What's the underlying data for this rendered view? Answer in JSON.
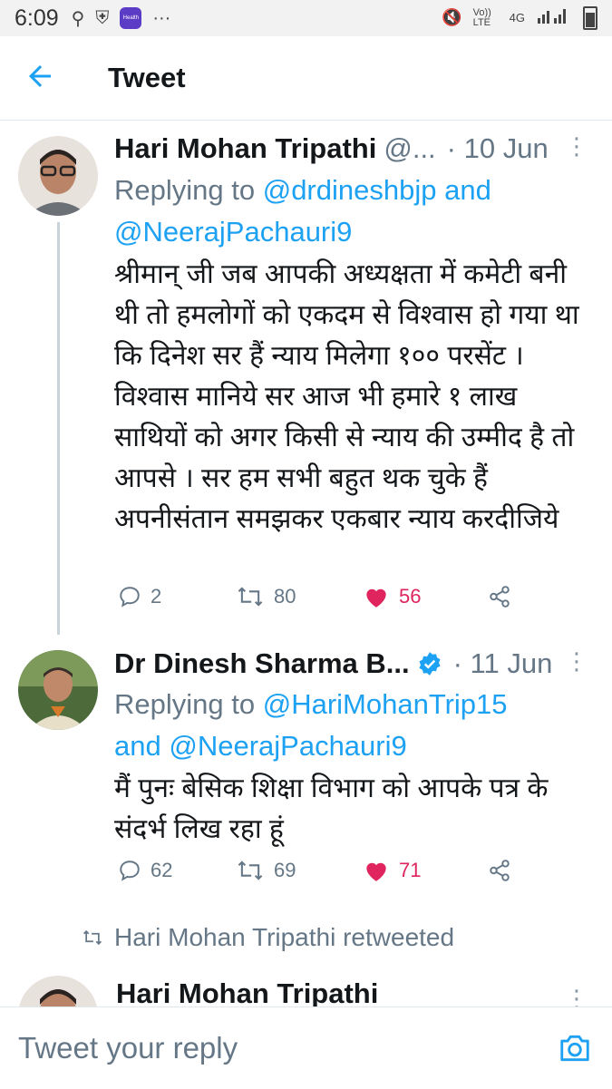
{
  "status_bar": {
    "time": "6:09",
    "dots": "···",
    "health_badge_label": "Health",
    "network": "4G",
    "volte": "Vo)) LTE"
  },
  "header": {
    "title": "Tweet"
  },
  "tweets": [
    {
      "name": "Hari Mohan Tripathi",
      "handle": "@...",
      "date": "· 10 Jun",
      "replying_prefix": "Replying to ",
      "mention_1": "@drdineshbjp",
      "and_word": "and",
      "mention_2": "@NeerajPachauri9",
      "body": "श्रीमान् जी जब आपकी अध्यक्षता में कमेटी बनी थी तो हमलोगों को एकदम से विश्वास हो गया था कि दिनेश सर हैं न्याय मिलेगा १०० परसेंट ।विश्वास मानिये सर आज भी हमारे १ लाख साथियों को अगर किसी से न्याय की उम्मीद है तो आपसे । सर हम सभी बहुत थक चुके हैं अपनीसंतान समझकर एकबार न्याय करदीजिये",
      "replies": "2",
      "retweets": "80",
      "likes": "56"
    },
    {
      "name": "Dr Dinesh Sharma B...",
      "date": "· 11 Jun",
      "replying_prefix": "Replying to ",
      "mention_1": "@HariMohanTrip15",
      "and_word": "and",
      "mention_2": "@NeerajPachauri9",
      "body": "मैं  पुनः बेसिक शिक्षा विभाग को आपके पत्र के संदर्भ लिख रहा हूं",
      "replies": "62",
      "retweets": "69",
      "likes": "71"
    }
  ],
  "retweeted_label": "Hari Mohan Tripathi retweeted",
  "next_tweet": {
    "name": "Hari Mohan Tripathi"
  },
  "reply_bar": {
    "placeholder": "Tweet your reply"
  },
  "colors": {
    "accent": "#1da1f2",
    "like": "#e0245e",
    "muted": "#657786"
  }
}
